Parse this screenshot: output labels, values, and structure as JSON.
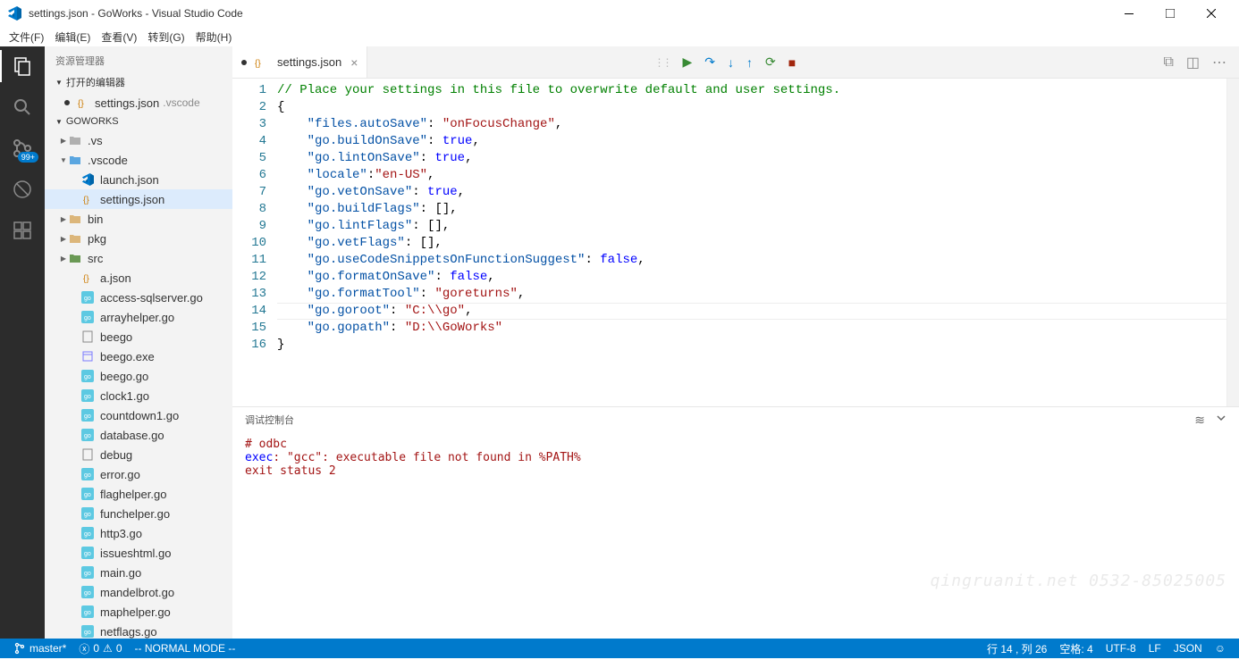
{
  "window": {
    "title": "settings.json - GoWorks - Visual Studio Code"
  },
  "menu": [
    "文件(F)",
    "编辑(E)",
    "查看(V)",
    "转到(G)",
    "帮助(H)"
  ],
  "activity": {
    "badge": "99+"
  },
  "sidebar": {
    "title": "资源管理器",
    "openEditors": "打开的编辑器",
    "openFile": {
      "name": "settings.json",
      "dir": ".vscode"
    },
    "root": "GOWORKS",
    "tree": [
      {
        "depth": 1,
        "arrow": "▶",
        "icon": "folder-grey",
        "label": ".vs"
      },
      {
        "depth": 1,
        "arrow": "▼",
        "icon": "folder-blue",
        "label": ".vscode"
      },
      {
        "depth": 2,
        "arrow": "",
        "icon": "vslogo",
        "label": "launch.json"
      },
      {
        "depth": 2,
        "arrow": "",
        "icon": "json",
        "label": "settings.json",
        "sel": true
      },
      {
        "depth": 1,
        "arrow": "▶",
        "icon": "folder-yellow",
        "label": "bin"
      },
      {
        "depth": 1,
        "arrow": "▶",
        "icon": "folder-yellow",
        "label": "pkg"
      },
      {
        "depth": 1,
        "arrow": "▶",
        "icon": "folder-green",
        "label": "src"
      },
      {
        "depth": 2,
        "arrow": "",
        "icon": "json",
        "label": "a.json"
      },
      {
        "depth": 2,
        "arrow": "",
        "icon": "go",
        "label": "access-sqlserver.go"
      },
      {
        "depth": 2,
        "arrow": "",
        "icon": "go",
        "label": "arrayhelper.go"
      },
      {
        "depth": 2,
        "arrow": "",
        "icon": "file",
        "label": "beego"
      },
      {
        "depth": 2,
        "arrow": "",
        "icon": "exe",
        "label": "beego.exe"
      },
      {
        "depth": 2,
        "arrow": "",
        "icon": "go",
        "label": "beego.go"
      },
      {
        "depth": 2,
        "arrow": "",
        "icon": "go",
        "label": "clock1.go"
      },
      {
        "depth": 2,
        "arrow": "",
        "icon": "go",
        "label": "countdown1.go"
      },
      {
        "depth": 2,
        "arrow": "",
        "icon": "go",
        "label": "database.go"
      },
      {
        "depth": 2,
        "arrow": "",
        "icon": "file",
        "label": "debug"
      },
      {
        "depth": 2,
        "arrow": "",
        "icon": "go",
        "label": "error.go"
      },
      {
        "depth": 2,
        "arrow": "",
        "icon": "go",
        "label": "flaghelper.go"
      },
      {
        "depth": 2,
        "arrow": "",
        "icon": "go",
        "label": "funchelper.go"
      },
      {
        "depth": 2,
        "arrow": "",
        "icon": "go",
        "label": "http3.go"
      },
      {
        "depth": 2,
        "arrow": "",
        "icon": "go",
        "label": "issueshtml.go"
      },
      {
        "depth": 2,
        "arrow": "",
        "icon": "go",
        "label": "main.go"
      },
      {
        "depth": 2,
        "arrow": "",
        "icon": "go",
        "label": "mandelbrot.go"
      },
      {
        "depth": 2,
        "arrow": "",
        "icon": "go",
        "label": "maphelper.go"
      },
      {
        "depth": 2,
        "arrow": "",
        "icon": "go",
        "label": "netflags.go"
      }
    ]
  },
  "tab": {
    "name": "settings.json",
    "dirty": true
  },
  "code": {
    "lines": [
      [
        {
          "t": "// Place your settings in this file to overwrite default and user settings.",
          "c": "c-comment"
        }
      ],
      [
        {
          "t": "{",
          "c": "c-punc"
        }
      ],
      [
        {
          "t": "    ",
          "c": ""
        },
        {
          "t": "\"files.autoSave\"",
          "c": "c-key"
        },
        {
          "t": ": ",
          "c": "c-punc"
        },
        {
          "t": "\"onFocusChange\"",
          "c": "c-str"
        },
        {
          "t": ",",
          "c": "c-punc"
        }
      ],
      [
        {
          "t": "    ",
          "c": ""
        },
        {
          "t": "\"go.buildOnSave\"",
          "c": "c-key"
        },
        {
          "t": ": ",
          "c": "c-punc"
        },
        {
          "t": "true",
          "c": "c-bool"
        },
        {
          "t": ",",
          "c": "c-punc"
        }
      ],
      [
        {
          "t": "    ",
          "c": ""
        },
        {
          "t": "\"go.lintOnSave\"",
          "c": "c-key"
        },
        {
          "t": ": ",
          "c": "c-punc"
        },
        {
          "t": "true",
          "c": "c-bool"
        },
        {
          "t": ",",
          "c": "c-punc"
        }
      ],
      [
        {
          "t": "    ",
          "c": ""
        },
        {
          "t": "\"locale\"",
          "c": "c-key"
        },
        {
          "t": ":",
          "c": "c-punc"
        },
        {
          "t": "\"en-US\"",
          "c": "c-str"
        },
        {
          "t": ",",
          "c": "c-punc"
        }
      ],
      [
        {
          "t": "    ",
          "c": ""
        },
        {
          "t": "\"go.vetOnSave\"",
          "c": "c-key"
        },
        {
          "t": ": ",
          "c": "c-punc"
        },
        {
          "t": "true",
          "c": "c-bool"
        },
        {
          "t": ",",
          "c": "c-punc"
        }
      ],
      [
        {
          "t": "    ",
          "c": ""
        },
        {
          "t": "\"go.buildFlags\"",
          "c": "c-key"
        },
        {
          "t": ": [],",
          "c": "c-punc"
        }
      ],
      [
        {
          "t": "    ",
          "c": ""
        },
        {
          "t": "\"go.lintFlags\"",
          "c": "c-key"
        },
        {
          "t": ": [],",
          "c": "c-punc"
        }
      ],
      [
        {
          "t": "    ",
          "c": ""
        },
        {
          "t": "\"go.vetFlags\"",
          "c": "c-key"
        },
        {
          "t": ": [],",
          "c": "c-punc"
        }
      ],
      [
        {
          "t": "    ",
          "c": ""
        },
        {
          "t": "\"go.useCodeSnippetsOnFunctionSuggest\"",
          "c": "c-key"
        },
        {
          "t": ": ",
          "c": "c-punc"
        },
        {
          "t": "false",
          "c": "c-bool"
        },
        {
          "t": ",",
          "c": "c-punc"
        }
      ],
      [
        {
          "t": "    ",
          "c": ""
        },
        {
          "t": "\"go.formatOnSave\"",
          "c": "c-key"
        },
        {
          "t": ": ",
          "c": "c-punc"
        },
        {
          "t": "false",
          "c": "c-bool"
        },
        {
          "t": ",",
          "c": "c-punc"
        }
      ],
      [
        {
          "t": "    ",
          "c": ""
        },
        {
          "t": "\"go.formatTool\"",
          "c": "c-key"
        },
        {
          "t": ": ",
          "c": "c-punc"
        },
        {
          "t": "\"goreturns\"",
          "c": "c-str"
        },
        {
          "t": ",",
          "c": "c-punc"
        }
      ],
      [
        {
          "t": "    ",
          "c": ""
        },
        {
          "t": "\"go.goroot\"",
          "c": "c-key"
        },
        {
          "t": ": ",
          "c": "c-punc"
        },
        {
          "t": "\"C:\\\\go\"",
          "c": "c-str"
        },
        {
          "t": ",",
          "c": "c-punc"
        }
      ],
      [
        {
          "t": "    ",
          "c": ""
        },
        {
          "t": "\"go.gopath\"",
          "c": "c-key"
        },
        {
          "t": ": ",
          "c": "c-punc"
        },
        {
          "t": "\"D:\\\\GoWorks\"",
          "c": "c-str"
        }
      ],
      [
        {
          "t": "}",
          "c": "c-punc"
        }
      ]
    ],
    "highlightLine": 14
  },
  "panel": {
    "title": "调试控制台",
    "lines": [
      {
        "text": "# odbc",
        "cls": "err"
      },
      {
        "text": "exec: \"gcc\": executable file not found in %PATH%",
        "cls": "err",
        "kw": "exec"
      },
      {
        "text": "exit status 2",
        "cls": "err"
      }
    ]
  },
  "watermark": "qingruanit.net 0532-85025005",
  "status": {
    "branch": "master*",
    "errors": "0",
    "warnings": "0",
    "mode": "-- NORMAL MODE --",
    "pos": "行 14 , 列 26",
    "spaces": "空格: 4",
    "encoding": "UTF-8",
    "eol": "LF",
    "lang": "JSON"
  }
}
